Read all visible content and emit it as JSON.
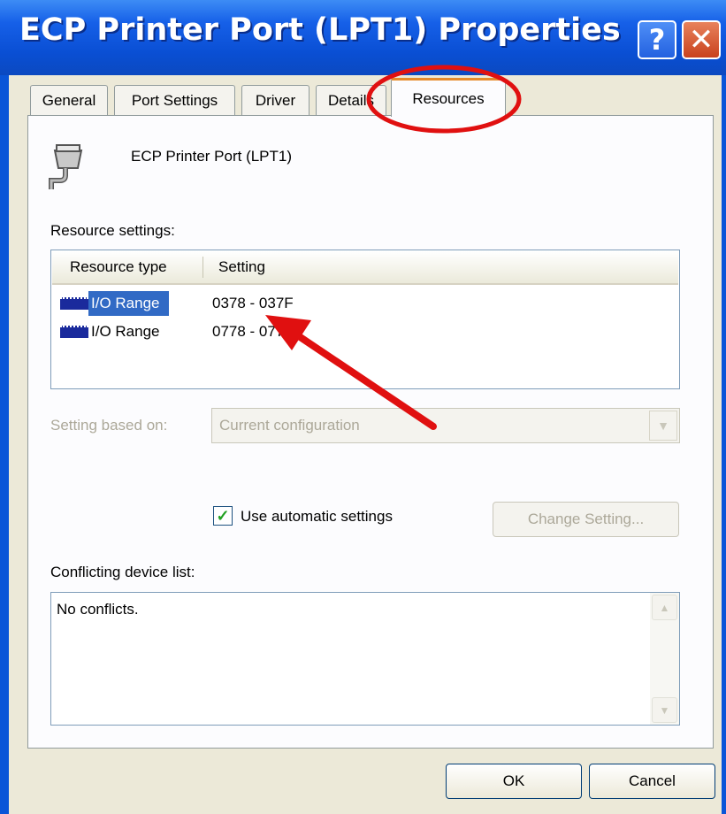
{
  "window": {
    "title": "ECP Printer Port (LPT1) Properties",
    "help_glyph": "?",
    "close_glyph": "✕"
  },
  "tabs": [
    {
      "label": "General"
    },
    {
      "label": "Port Settings"
    },
    {
      "label": "Driver"
    },
    {
      "label": "Details"
    },
    {
      "label": "Resources",
      "active": true
    }
  ],
  "device": {
    "name": "ECP Printer Port (LPT1)",
    "icon": "parallel-port-icon"
  },
  "resource_settings": {
    "label": "Resource settings:",
    "columns": [
      "Resource type",
      "Setting"
    ],
    "rows": [
      {
        "type": "I/O Range",
        "setting": "0378 - 037F",
        "selected": true,
        "icon": "chip-icon"
      },
      {
        "type": "I/O Range",
        "setting": "0778 - 077B",
        "selected": false,
        "icon": "chip-icon"
      }
    ]
  },
  "setting_based_on": {
    "label": "Setting based on:",
    "value": "Current configuration"
  },
  "auto_settings": {
    "label": "Use automatic settings",
    "checked": true
  },
  "change_setting_button": "Change Setting...",
  "conflicts": {
    "label": "Conflicting device list:",
    "text": "No conflicts."
  },
  "buttons": {
    "ok": "OK",
    "cancel": "Cancel"
  },
  "annotations": {
    "circle_color": "#e01010",
    "arrow_color": "#e01010"
  }
}
